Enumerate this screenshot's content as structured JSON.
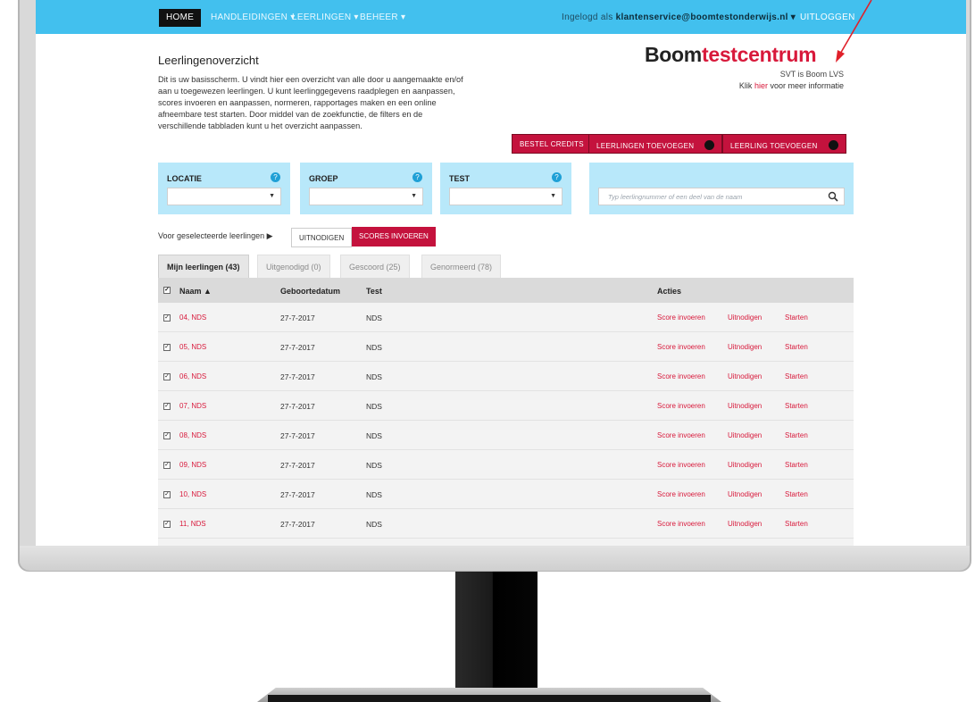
{
  "nav": {
    "home": "HOME",
    "handleidingen": "HANDLEIDINGEN ▾",
    "leerlingen": "LEERLINGEN ▾",
    "beheer": "BEHEER ▾",
    "user_prefix": "Ingelogd als",
    "user_email": "klantenservice@boomtestonderwijs.nl ▾",
    "logout": "UITLOGGEN"
  },
  "header": {
    "title": "Leerlingenoverzicht",
    "intro": "Dit is uw basisscherm. U vindt hier een overzicht van alle door u aangemaakte en/of aan u toegewezen leerlingen. U kunt leerlinggegevens raadplegen en aanpassen, scores invoeren en aanpassen, normeren, rapportages maken en een online afneembare test starten. Door middel van de zoekfunctie, de filters en de verschillende tabbladen kunt u het overzicht aanpassen.",
    "logo_black": "Boom",
    "logo_red": "testcentrum",
    "logo_sub": "SVT is Boom LVS",
    "logo_link_pre": "Klik",
    "logo_link_red": "hier",
    "logo_link_post": "voor meer informatie"
  },
  "buttons": {
    "bestel_credits": "BESTEL CREDITS",
    "leerlingen_toevoegen": "LEERLINGEN TOEVOEGEN",
    "leerling_toevoegen": "LEERLING TOEVOEGEN",
    "uitnodigen": "UITNODIGEN",
    "scores_invoeren": "SCORES INVOEREN"
  },
  "filters": {
    "locatie": "LOCATIE",
    "groep": "GROEP",
    "test": "TEST",
    "help": "?",
    "search_placeholder": "Typ leerlingnummer of een deel van de naam"
  },
  "selection_label": "Voor geselecteerde leerlingen ▶",
  "tabs": {
    "mijn": "Mijn leerlingen (43)",
    "uitgenodigd": "Uitgenodigd (0)",
    "gescoord": "Gescoord (25)",
    "genormeerd": "Genormeerd (78)"
  },
  "table": {
    "col_name": "Naam ▲",
    "col_date": "Geboortedatum",
    "col_test": "Test",
    "col_actions": "Acties",
    "action_score": "Score invoeren",
    "action_invite": "Uitnodigen",
    "action_start": "Starten",
    "rows": [
      {
        "name": "04, NDS",
        "date": "27-7-2017",
        "test": "NDS"
      },
      {
        "name": "05, NDS",
        "date": "27-7-2017",
        "test": "NDS"
      },
      {
        "name": "06, NDS",
        "date": "27-7-2017",
        "test": "NDS"
      },
      {
        "name": "07, NDS",
        "date": "27-7-2017",
        "test": "NDS"
      },
      {
        "name": "08, NDS",
        "date": "27-7-2017",
        "test": "NDS"
      },
      {
        "name": "09, NDS",
        "date": "27-7-2017",
        "test": "NDS"
      },
      {
        "name": "10, NDS",
        "date": "27-7-2017",
        "test": "NDS"
      },
      {
        "name": "11, NDS",
        "date": "27-7-2017",
        "test": "NDS"
      }
    ]
  },
  "colors": {
    "nav": "#42c0ee",
    "accent_red": "#c4123d",
    "filter_bg": "#b8e8fa",
    "annotation_arrow": "#e0202a"
  }
}
